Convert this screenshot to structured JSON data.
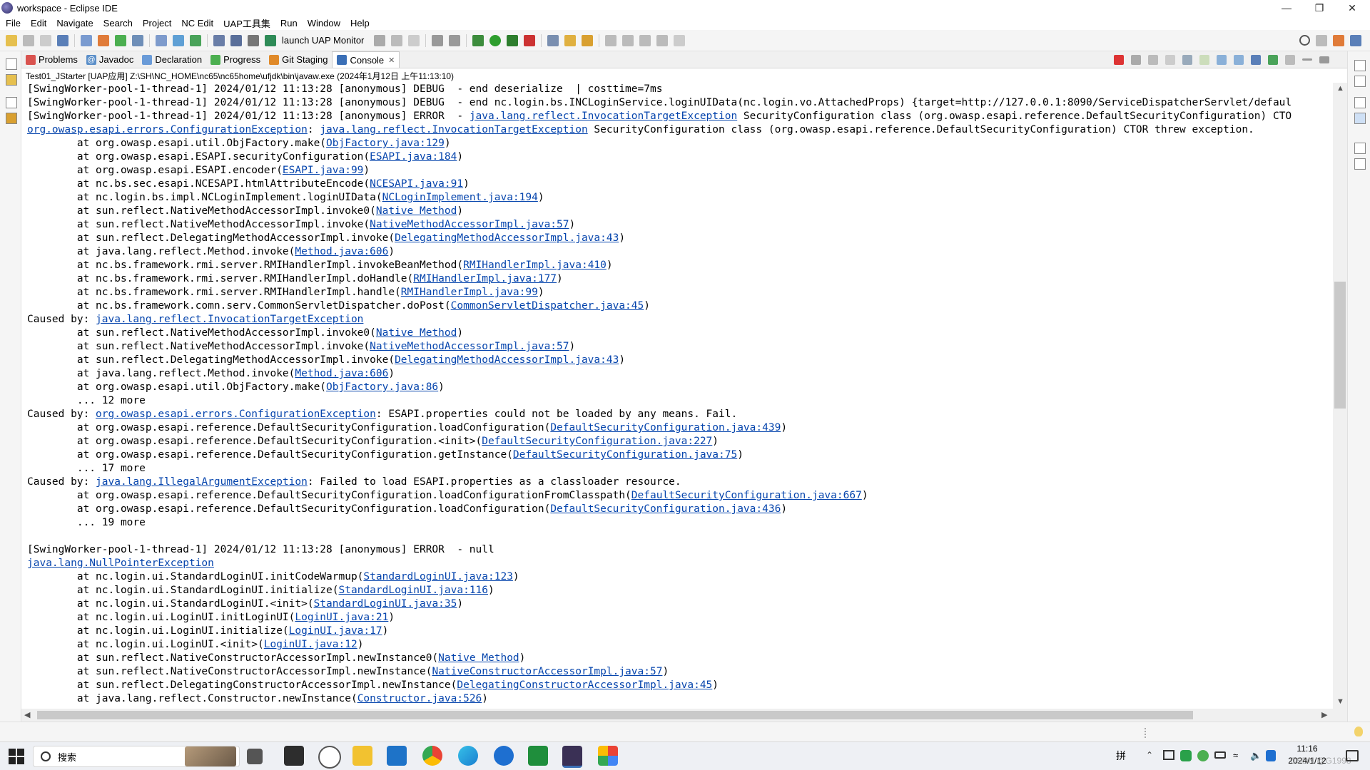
{
  "window": {
    "title": "workspace - Eclipse IDE"
  },
  "menu": [
    "File",
    "Edit",
    "Navigate",
    "Search",
    "Project",
    "NC Edit",
    "UAP工具集",
    "Run",
    "Window",
    "Help"
  ],
  "toolbar": {
    "launch_label": "launch UAP Monitor"
  },
  "tabs": [
    {
      "label": "Problems",
      "icon": "problems-icon",
      "color": "#d9534f"
    },
    {
      "label": "Javadoc",
      "icon": "javadoc-icon",
      "color": "#5b8fc9"
    },
    {
      "label": "Declaration",
      "icon": "declaration-icon",
      "color": "#6a9bd8"
    },
    {
      "label": "Progress",
      "icon": "progress-icon",
      "color": "#4caf50"
    },
    {
      "label": "Git Staging",
      "icon": "git-staging-icon",
      "color": "#e08a2a"
    },
    {
      "label": "Console",
      "icon": "console-icon",
      "color": "#3b6fb6"
    }
  ],
  "console": {
    "launch_info": "Test01_JStarter [UAP应用] Z:\\SH\\NC_HOME\\nc65\\nc65home\\ufjdk\\bin\\javaw.exe  (2024年1月12日 上午11:13:10)",
    "lines": [
      [
        {
          "t": "[SwingWorker-pool-1-thread-1] 2024/01/12 11:13:28 [anonymous] DEBUG  - end deserialize  | costtime=7ms"
        }
      ],
      [
        {
          "t": "[SwingWorker-pool-1-thread-1] 2024/01/12 11:13:28 [anonymous] DEBUG  - end nc.login.bs.INCLoginService.loginUIData(nc.login.vo.AttachedProps) {target=http://127.0.0.1:8090/ServiceDispatcherServlet/defaul"
        }
      ],
      [
        {
          "t": "[SwingWorker-pool-1-thread-1] 2024/01/12 11:13:28 [anonymous] ERROR  - "
        },
        {
          "t": "java.lang.reflect.InvocationTargetException",
          "l": 1
        },
        {
          "t": " SecurityConfiguration class (org.owasp.esapi.reference.DefaultSecurityConfiguration) CTO"
        }
      ],
      [
        {
          "t": "org.owasp.esapi.errors.ConfigurationException",
          "l": 1
        },
        {
          "t": ": "
        },
        {
          "t": "java.lang.reflect.InvocationTargetException",
          "l": 1
        },
        {
          "t": " SecurityConfiguration class (org.owasp.esapi.reference.DefaultSecurityConfiguration) CTOR threw exception."
        }
      ],
      [
        {
          "t": "\tat org.owasp.esapi.util.ObjFactory.make("
        },
        {
          "t": "ObjFactory.java:129",
          "l": 1
        },
        {
          "t": ")"
        }
      ],
      [
        {
          "t": "\tat org.owasp.esapi.ESAPI.securityConfiguration("
        },
        {
          "t": "ESAPI.java:184",
          "l": 1
        },
        {
          "t": ")"
        }
      ],
      [
        {
          "t": "\tat org.owasp.esapi.ESAPI.encoder("
        },
        {
          "t": "ESAPI.java:99",
          "l": 1
        },
        {
          "t": ")"
        }
      ],
      [
        {
          "t": "\tat nc.bs.sec.esapi.NCESAPI.htmlAttributeEncode("
        },
        {
          "t": "NCESAPI.java:91",
          "l": 1
        },
        {
          "t": ")"
        }
      ],
      [
        {
          "t": "\tat nc.login.bs.impl.NCLoginImplement.loginUIData("
        },
        {
          "t": "NCLoginImplement.java:194",
          "l": 1
        },
        {
          "t": ")"
        }
      ],
      [
        {
          "t": "\tat sun.reflect.NativeMethodAccessorImpl.invoke0("
        },
        {
          "t": "Native Method",
          "l": 1
        },
        {
          "t": ")"
        }
      ],
      [
        {
          "t": "\tat sun.reflect.NativeMethodAccessorImpl.invoke("
        },
        {
          "t": "NativeMethodAccessorImpl.java:57",
          "l": 1
        },
        {
          "t": ")"
        }
      ],
      [
        {
          "t": "\tat sun.reflect.DelegatingMethodAccessorImpl.invoke("
        },
        {
          "t": "DelegatingMethodAccessorImpl.java:43",
          "l": 1
        },
        {
          "t": ")"
        }
      ],
      [
        {
          "t": "\tat java.lang.reflect.Method.invoke("
        },
        {
          "t": "Method.java:606",
          "l": 1
        },
        {
          "t": ")"
        }
      ],
      [
        {
          "t": "\tat nc.bs.framework.rmi.server.RMIHandlerImpl.invokeBeanMethod("
        },
        {
          "t": "RMIHandlerImpl.java:410",
          "l": 1
        },
        {
          "t": ")"
        }
      ],
      [
        {
          "t": "\tat nc.bs.framework.rmi.server.RMIHandlerImpl.doHandle("
        },
        {
          "t": "RMIHandlerImpl.java:177",
          "l": 1
        },
        {
          "t": ")"
        }
      ],
      [
        {
          "t": "\tat nc.bs.framework.rmi.server.RMIHandlerImpl.handle("
        },
        {
          "t": "RMIHandlerImpl.java:99",
          "l": 1
        },
        {
          "t": ")"
        }
      ],
      [
        {
          "t": "\tat nc.bs.framework.comn.serv.CommonServletDispatcher.doPost("
        },
        {
          "t": "CommonServletDispatcher.java:45",
          "l": 1
        },
        {
          "t": ")"
        }
      ],
      [
        {
          "t": "Caused by: "
        },
        {
          "t": "java.lang.reflect.InvocationTargetException",
          "l": 1
        }
      ],
      [
        {
          "t": "\tat sun.reflect.NativeMethodAccessorImpl.invoke0("
        },
        {
          "t": "Native Method",
          "l": 1
        },
        {
          "t": ")"
        }
      ],
      [
        {
          "t": "\tat sun.reflect.NativeMethodAccessorImpl.invoke("
        },
        {
          "t": "NativeMethodAccessorImpl.java:57",
          "l": 1
        },
        {
          "t": ")"
        }
      ],
      [
        {
          "t": "\tat sun.reflect.DelegatingMethodAccessorImpl.invoke("
        },
        {
          "t": "DelegatingMethodAccessorImpl.java:43",
          "l": 1
        },
        {
          "t": ")"
        }
      ],
      [
        {
          "t": "\tat java.lang.reflect.Method.invoke("
        },
        {
          "t": "Method.java:606",
          "l": 1
        },
        {
          "t": ")"
        }
      ],
      [
        {
          "t": "\tat org.owasp.esapi.util.ObjFactory.make("
        },
        {
          "t": "ObjFactory.java:86",
          "l": 1
        },
        {
          "t": ")"
        }
      ],
      [
        {
          "t": "\t... 12 more"
        }
      ],
      [
        {
          "t": "Caused by: "
        },
        {
          "t": "org.owasp.esapi.errors.ConfigurationException",
          "l": 1
        },
        {
          "t": ": ESAPI.properties could not be loaded by any means. Fail."
        }
      ],
      [
        {
          "t": "\tat org.owasp.esapi.reference.DefaultSecurityConfiguration.loadConfiguration("
        },
        {
          "t": "DefaultSecurityConfiguration.java:439",
          "l": 1
        },
        {
          "t": ")"
        }
      ],
      [
        {
          "t": "\tat org.owasp.esapi.reference.DefaultSecurityConfiguration.<init>("
        },
        {
          "t": "DefaultSecurityConfiguration.java:227",
          "l": 1
        },
        {
          "t": ")"
        }
      ],
      [
        {
          "t": "\tat org.owasp.esapi.reference.DefaultSecurityConfiguration.getInstance("
        },
        {
          "t": "DefaultSecurityConfiguration.java:75",
          "l": 1
        },
        {
          "t": ")"
        }
      ],
      [
        {
          "t": "\t... 17 more"
        }
      ],
      [
        {
          "t": "Caused by: "
        },
        {
          "t": "java.lang.IllegalArgumentException",
          "l": 1
        },
        {
          "t": ": Failed to load ESAPI.properties as a classloader resource."
        }
      ],
      [
        {
          "t": "\tat org.owasp.esapi.reference.DefaultSecurityConfiguration.loadConfigurationFromClasspath("
        },
        {
          "t": "DefaultSecurityConfiguration.java:667",
          "l": 1
        },
        {
          "t": ")"
        }
      ],
      [
        {
          "t": "\tat org.owasp.esapi.reference.DefaultSecurityConfiguration.loadConfiguration("
        },
        {
          "t": "DefaultSecurityConfiguration.java:436",
          "l": 1
        },
        {
          "t": ")"
        }
      ],
      [
        {
          "t": "\t... 19 more"
        }
      ],
      [
        {
          "t": ""
        }
      ],
      [
        {
          "t": "[SwingWorker-pool-1-thread-1] 2024/01/12 11:13:28 [anonymous] ERROR  - null"
        }
      ],
      [
        {
          "t": "java.lang.NullPointerException",
          "l": 1
        }
      ],
      [
        {
          "t": "\tat nc.login.ui.StandardLoginUI.initCodeWarmup("
        },
        {
          "t": "StandardLoginUI.java:123",
          "l": 1
        },
        {
          "t": ")"
        }
      ],
      [
        {
          "t": "\tat nc.login.ui.StandardLoginUI.initialize("
        },
        {
          "t": "StandardLoginUI.java:116",
          "l": 1
        },
        {
          "t": ")"
        }
      ],
      [
        {
          "t": "\tat nc.login.ui.StandardLoginUI.<init>("
        },
        {
          "t": "StandardLoginUI.java:35",
          "l": 1
        },
        {
          "t": ")"
        }
      ],
      [
        {
          "t": "\tat nc.login.ui.LoginUI.initLoginUI("
        },
        {
          "t": "LoginUI.java:21",
          "l": 1
        },
        {
          "t": ")"
        }
      ],
      [
        {
          "t": "\tat nc.login.ui.LoginUI.initialize("
        },
        {
          "t": "LoginUI.java:17",
          "l": 1
        },
        {
          "t": ")"
        }
      ],
      [
        {
          "t": "\tat nc.login.ui.LoginUI.<init>("
        },
        {
          "t": "LoginUI.java:12",
          "l": 1
        },
        {
          "t": ")"
        }
      ],
      [
        {
          "t": "\tat sun.reflect.NativeConstructorAccessorImpl.newInstance0("
        },
        {
          "t": "Native Method",
          "l": 1
        },
        {
          "t": ")"
        }
      ],
      [
        {
          "t": "\tat sun.reflect.NativeConstructorAccessorImpl.newInstance("
        },
        {
          "t": "NativeConstructorAccessorImpl.java:57",
          "l": 1
        },
        {
          "t": ")"
        }
      ],
      [
        {
          "t": "\tat sun.reflect.DelegatingConstructorAccessorImpl.newInstance("
        },
        {
          "t": "DelegatingConstructorAccessorImpl.java:45",
          "l": 1
        },
        {
          "t": ")"
        }
      ],
      [
        {
          "t": "\tat java.lang.reflect.Constructor.newInstance("
        },
        {
          "t": "Constructor.java:526",
          "l": 1
        },
        {
          "t": ")"
        }
      ]
    ]
  },
  "taskbar": {
    "search_placeholder": "搜索",
    "time": "11:16",
    "date": "2024/1/12",
    "ime": "拼",
    "watermark": "CSDN @G1998"
  },
  "colors": {
    "link": "#0645ad",
    "toolbar_bg": "#f5f5f5",
    "accent": "#3b6fb6"
  }
}
